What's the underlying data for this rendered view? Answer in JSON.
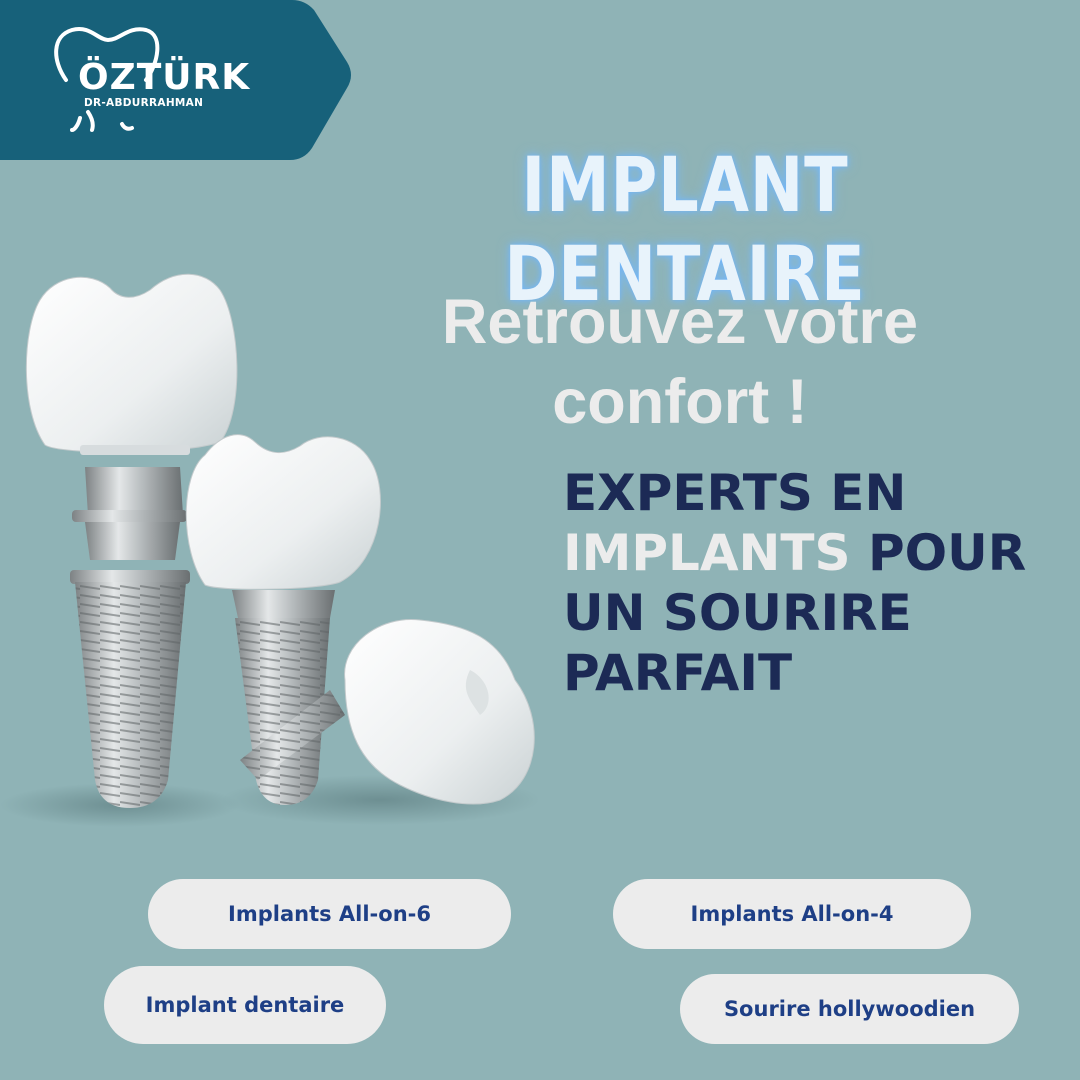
{
  "brand": {
    "name": "ÖZTÜRK",
    "subtitle": "DR-ABDURRAHMAN",
    "banner_color": "#17617a"
  },
  "headline": "IMPLANT DENTAIRE",
  "tagline": "Retrouvez votre confort !",
  "experts": {
    "part1": "EXPERTS EN",
    "highlight": "IMPLANTS",
    "part2": "POUR UN SOURIRE PARFAIT"
  },
  "services": [
    "Implants All-on-6",
    "Implants All-on-4",
    "Implant dentaire",
    "Sourire hollywoodien"
  ],
  "colors": {
    "background": "#8fb3b6",
    "navy_text": "#1c2a55",
    "pill_text": "#1e3f86",
    "pill_bg": "#ececec"
  }
}
